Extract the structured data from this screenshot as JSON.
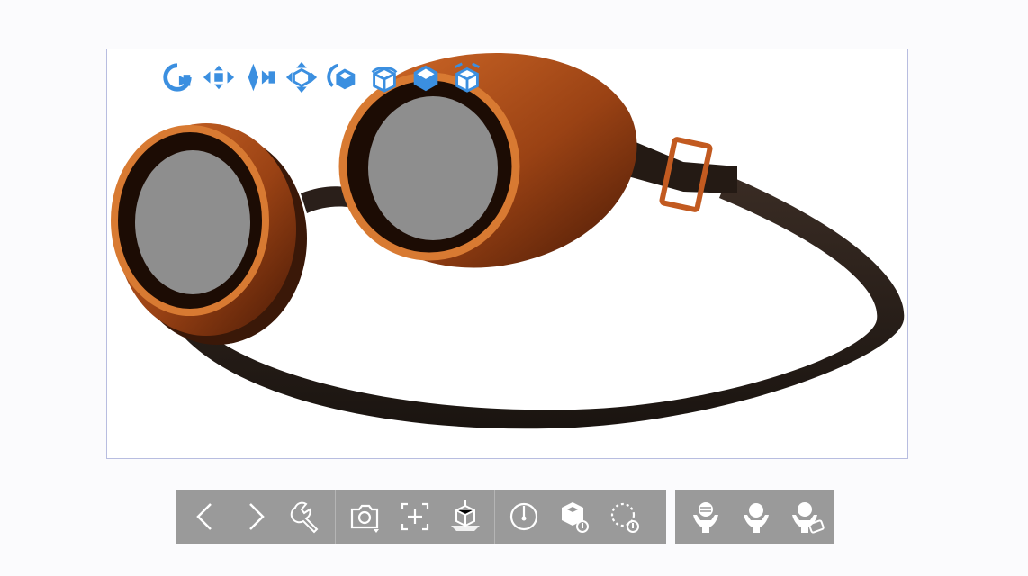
{
  "viewport": {
    "model_name": "goggles",
    "colors": {
      "frame": "#b8561e",
      "frame_dark": "#5a2208",
      "lens": "#8e8e8e",
      "strap": "#2a1f1a",
      "border": "#b8bde0"
    }
  },
  "view_toolbar": {
    "icon_color": "#3b8fe0",
    "buttons": [
      {
        "icon": "rotate-left-icon"
      },
      {
        "icon": "move-horizontal-icon"
      },
      {
        "icon": "move-vertical-icon"
      },
      {
        "icon": "move-all-icon"
      },
      {
        "icon": "rotate-3d-icon"
      },
      {
        "icon": "orbit-cube-icon"
      },
      {
        "icon": "top-view-cube-icon"
      },
      {
        "icon": "explode-cube-icon"
      }
    ]
  },
  "bottom_toolbar": {
    "background": "#9a9a9a",
    "icon_color": "#ffffff",
    "groups": [
      [
        "chevron-left-icon",
        "chevron-right-icon",
        "wrench-icon"
      ],
      [
        "camera-icon",
        "fit-frame-icon",
        "section-cube-icon"
      ],
      [
        "timer-icon",
        "cube-material-icon",
        "dotted-rotate-icon"
      ]
    ],
    "hand_tools": [
      "hand-hold-sphere-icon",
      "hand-hold-bulb-icon",
      "hand-hold-label-icon"
    ]
  }
}
